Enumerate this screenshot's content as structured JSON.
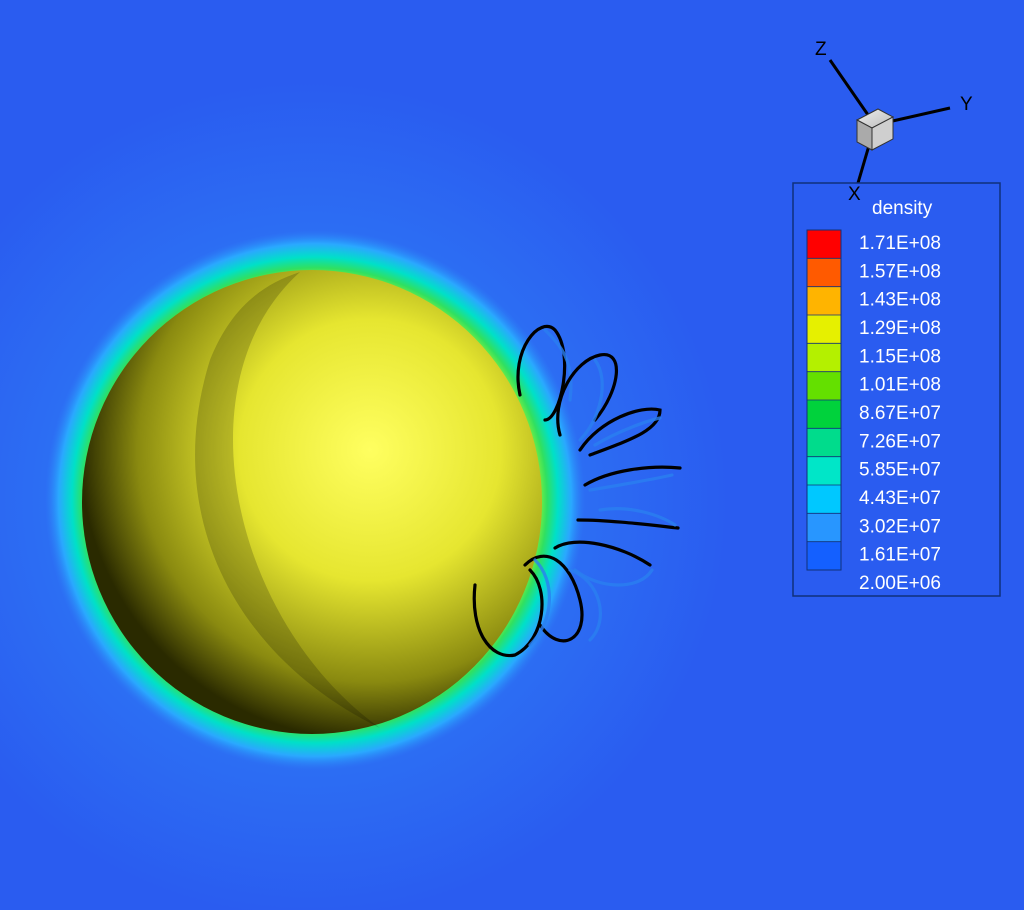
{
  "chart_data": {
    "type": "heatmap",
    "variable": "density",
    "colorbar": {
      "title": "density",
      "levels": [
        "1.71E+08",
        "1.57E+08",
        "1.43E+08",
        "1.29E+08",
        "1.15E+08",
        "1.01E+08",
        "8.67E+07",
        "7.26E+07",
        "5.85E+07",
        "4.43E+07",
        "3.02E+07",
        "1.61E+07",
        "2.00E+06"
      ],
      "colors": [
        "#ff0000",
        "#ff5a00",
        "#ffb400",
        "#e6f000",
        "#b4f000",
        "#64e000",
        "#00d23c",
        "#00dc8c",
        "#00e6c8",
        "#00c8ff",
        "#2896ff",
        "#1460ff",
        "#0a28ff"
      ],
      "placement": "right"
    },
    "axes_triad": {
      "labels": [
        "Z",
        "Y",
        "X"
      ]
    },
    "background_color": "#2a5cf0",
    "sphere_color": "#ffff40",
    "streamline_color": "#000000"
  }
}
